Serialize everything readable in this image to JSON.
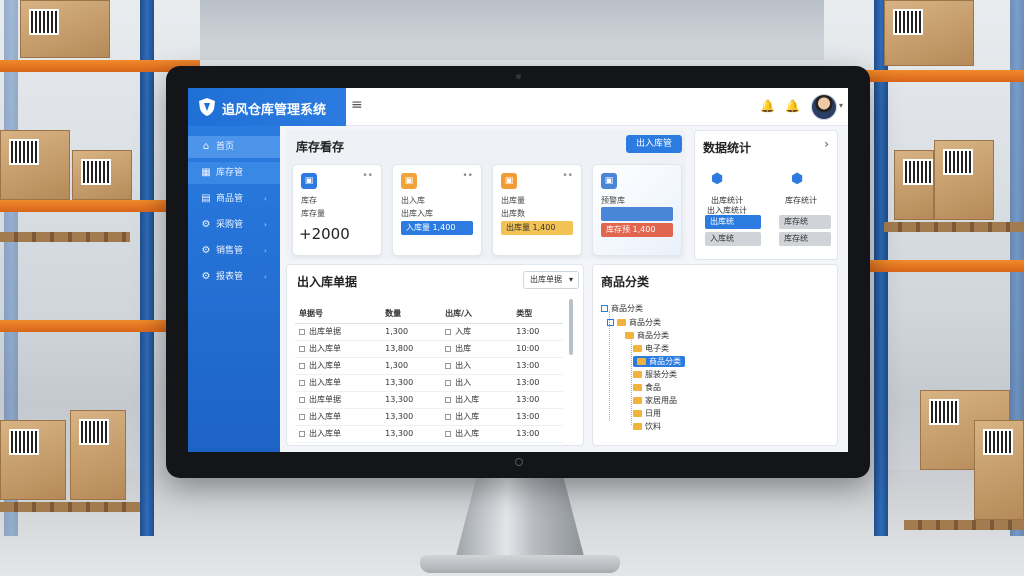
{
  "app": {
    "title": "追风仓库管理系统",
    "menu_icon": "menu-icon"
  },
  "header": {
    "icons": [
      "notification-bell-icon",
      "alert-bell-icon"
    ],
    "avatar": "user-avatar"
  },
  "sidebar": {
    "items": [
      {
        "label": "首页",
        "icon": "home-icon",
        "active": true
      },
      {
        "label": "库存管",
        "icon": "inventory-icon",
        "active": false
      },
      {
        "label": "商品管",
        "icon": "goods-icon",
        "active": false
      },
      {
        "label": "采购管",
        "icon": "purchase-icon",
        "active": false
      },
      {
        "label": "销售管",
        "icon": "sales-icon",
        "active": false
      },
      {
        "label": "报表管",
        "icon": "report-icon",
        "active": false
      }
    ]
  },
  "inventory": {
    "title": "库存看存",
    "button": "出入库管",
    "cards": [
      {
        "line1": "库存",
        "line2": "库存量",
        "value": "+2000",
        "chip": "",
        "color": "#2b7be0"
      },
      {
        "line1": "出入库",
        "line2": "出库入库",
        "value": "",
        "chip": "入库量 1,400",
        "color": "#f0a33a"
      },
      {
        "line1": "出库量",
        "line2": "出库数",
        "value": "",
        "chip": "出库量 1,400",
        "color": "#f29c38"
      },
      {
        "line1": "预警库",
        "line2": "库存预",
        "value": "",
        "chip": "库存预 1,400",
        "color": "#4a86d8"
      }
    ]
  },
  "stats": {
    "title": "数据统计",
    "arrow": "›",
    "items": [
      {
        "line1": "出库统计",
        "line2": "出入库统计",
        "badge": "出库统",
        "badge2": "入库统"
      },
      {
        "line1": "库存统计",
        "line2": "",
        "badge": "库存统",
        "badge2": "库存统"
      }
    ]
  },
  "orders": {
    "title": "出入库单据",
    "filter": "出库单据",
    "columns": [
      "单据号",
      "数量",
      "出库/入",
      "类型"
    ],
    "rows": [
      [
        "出库单据",
        "1,300",
        "入库",
        "13:00"
      ],
      [
        "出入库单",
        "13,800",
        "出库",
        "10:00"
      ],
      [
        "出入库单",
        "1,300",
        "出入",
        "13:00"
      ],
      [
        "出入库单",
        "13,300",
        "出入",
        "13:00"
      ],
      [
        "出库单据",
        "13,300",
        "出入库",
        "13:00"
      ],
      [
        "出入库单",
        "13,300",
        "出入库",
        "13:00"
      ],
      [
        "出入库单",
        "13,300",
        "出入库",
        "13:00"
      ],
      [
        "出入库单",
        "13,300",
        "出入库",
        "13:00"
      ]
    ]
  },
  "categories": {
    "title": "商品分类",
    "nodes": [
      {
        "label": "商品分类",
        "level": 0
      },
      {
        "label": "商品分类",
        "level": 1
      },
      {
        "label": "商品分类",
        "level": 2
      },
      {
        "label": "电子类",
        "level": 3
      },
      {
        "label": "商品分类",
        "level": 2,
        "selected": true
      },
      {
        "label": "服装分类",
        "level": 2
      },
      {
        "label": "食品",
        "level": 2
      },
      {
        "label": "家居用品",
        "level": 2
      },
      {
        "label": "日用",
        "level": 2
      },
      {
        "label": "饮料",
        "level": 2
      }
    ]
  }
}
